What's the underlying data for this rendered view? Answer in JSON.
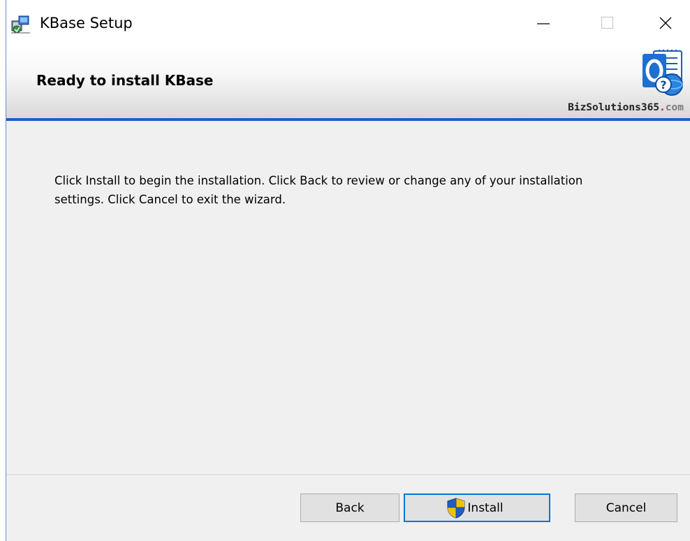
{
  "window": {
    "title": "KBase Setup",
    "controls": {
      "minimize": "minimize-icon",
      "maximize": "maximize-icon",
      "close": "close-icon"
    }
  },
  "banner": {
    "heading": "Ready to install KBase",
    "brand_name": "BizSolutions365",
    "brand_dot": ".",
    "brand_tld": "com",
    "logo_icon": "kbase-logo-icon"
  },
  "content": {
    "message_line1": "Click Install to begin the installation. Click Back to review or change any of your installation",
    "message_line2": "settings. Click Cancel to exit the wizard."
  },
  "buttons": {
    "back": "Back",
    "install": "Install",
    "install_icon": "uac-shield-icon",
    "cancel": "Cancel"
  },
  "colors": {
    "accent": "#1f5fbf",
    "focus_border": "#0078d7",
    "brand_dot": "#c81818"
  }
}
